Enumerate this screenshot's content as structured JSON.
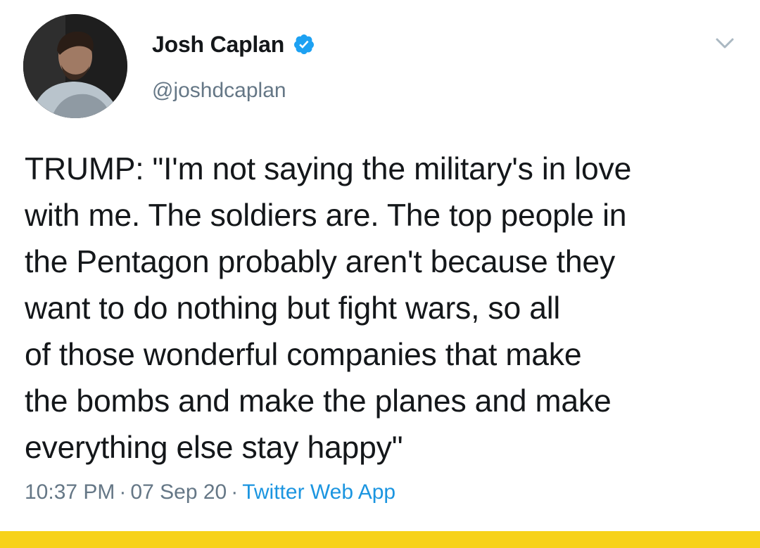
{
  "tweet": {
    "author": {
      "display_name": "Josh Caplan",
      "handle": "@joshdcaplan",
      "verified": true
    },
    "text_lines": [
      "TRUMP: \"I'm not saying the military's in love",
      "with me. The soldiers are. The top people in",
      "the Pentagon probably aren't because they",
      "want to do nothing but fight wars, so all",
      "of those wonderful companies that make",
      "the bombs and make the planes and make",
      "everything else stay happy\""
    ],
    "time": "10:37 PM",
    "separator": "·",
    "date": "07 Sep 20",
    "source": "Twitter Web App"
  },
  "icons": {
    "verified": "verified-badge-icon",
    "caret": "chevron-down-icon"
  },
  "colors": {
    "text": "#14171a",
    "secondary": "#657786",
    "link": "#1b95e0",
    "verified": "#1da1f2",
    "bottom_bar": "#f7d21a"
  }
}
